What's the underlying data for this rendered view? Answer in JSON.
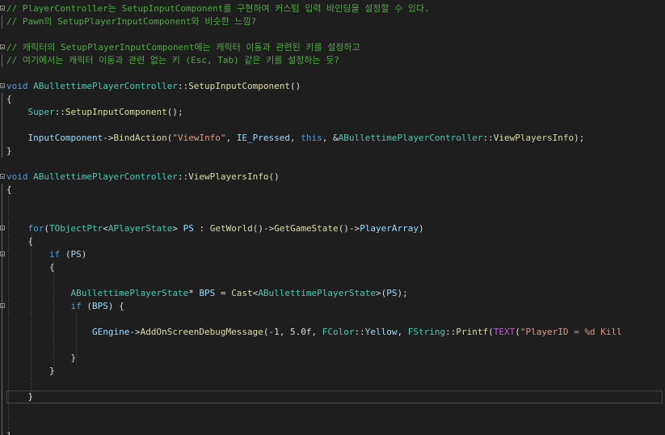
{
  "editor": {
    "theme_colors": {
      "background": "#1e1e1e",
      "comment": "#57a64a",
      "keyword": "#569cd6",
      "type": "#4ec9b0",
      "function": "#dcdcaa",
      "string": "#d69d85",
      "variable": "#9cdcfe",
      "plain": "#dcdcdc",
      "macro": "#bd63c5"
    },
    "lines": [
      [
        [
          "c",
          "// PlayerController는 SetupInputComponent를 구현하여 커스텀 입력 바인딩을 설정할 수 있다."
        ]
      ],
      [
        [
          "c",
          "// Pawn의 SetupPlayerInputComponent와 비슷한 느낌?"
        ]
      ],
      [],
      [
        [
          "c",
          "// 캐릭터의 SetupPlayerInputComponent에는 캐릭터 이동과 관련된 키를 설정하고"
        ]
      ],
      [
        [
          "c",
          "// 여기에서는 캐릭터 이동과 관련 없는 키 (Esc, Tab) 같은 키를 설정하는 듯?"
        ]
      ],
      [],
      [
        [
          "k",
          "void "
        ],
        [
          "t",
          "ABullettimePlayerController"
        ],
        [
          "p",
          "::"
        ],
        [
          "f",
          "SetupInputComponent"
        ],
        [
          "p",
          "()"
        ]
      ],
      [
        [
          "p",
          "{"
        ]
      ],
      [
        [
          "p",
          "    "
        ],
        [
          "t",
          "Super"
        ],
        [
          "p",
          "::"
        ],
        [
          "f",
          "SetupInputComponent"
        ],
        [
          "p",
          "();"
        ]
      ],
      [],
      [
        [
          "p",
          "    "
        ],
        [
          "v",
          "InputComponent"
        ],
        [
          "p",
          "->"
        ],
        [
          "f",
          "BindAction"
        ],
        [
          "p",
          "("
        ],
        [
          "s",
          "\"ViewInfo\""
        ],
        [
          "p",
          ", "
        ],
        [
          "v",
          "IE_Pressed"
        ],
        [
          "p",
          ", "
        ],
        [
          "k",
          "this"
        ],
        [
          "p",
          ", &"
        ],
        [
          "t",
          "ABullettimePlayerController"
        ],
        [
          "p",
          "::"
        ],
        [
          "f",
          "ViewPlayersInfo"
        ],
        [
          "p",
          ");"
        ]
      ],
      [
        [
          "p",
          "}"
        ]
      ],
      [],
      [
        [
          "k",
          "void "
        ],
        [
          "t",
          "ABullettimePlayerController"
        ],
        [
          "p",
          "::"
        ],
        [
          "f",
          "ViewPlayersInfo"
        ],
        [
          "p",
          "()"
        ]
      ],
      [
        [
          "p",
          "{"
        ]
      ],
      [],
      [],
      [
        [
          "p",
          "    "
        ],
        [
          "k",
          "for"
        ],
        [
          "p",
          "("
        ],
        [
          "t",
          "TObjectPtr"
        ],
        [
          "p",
          "<"
        ],
        [
          "t",
          "APlayerState"
        ],
        [
          "p",
          "> "
        ],
        [
          "v",
          "PS"
        ],
        [
          "p",
          " : "
        ],
        [
          "f",
          "GetWorld"
        ],
        [
          "p",
          "()->"
        ],
        [
          "f",
          "GetGameState"
        ],
        [
          "p",
          "()->"
        ],
        [
          "v",
          "PlayerArray"
        ],
        [
          "p",
          ")"
        ]
      ],
      [
        [
          "p",
          "    {"
        ]
      ],
      [
        [
          "p",
          "        "
        ],
        [
          "k",
          "if"
        ],
        [
          "p",
          " ("
        ],
        [
          "v",
          "PS"
        ],
        [
          "p",
          ")"
        ]
      ],
      [
        [
          "p",
          "        {"
        ]
      ],
      [],
      [
        [
          "p",
          "            "
        ],
        [
          "t",
          "ABullettimePlayerState"
        ],
        [
          "p",
          "* "
        ],
        [
          "v",
          "BPS"
        ],
        [
          "p",
          " = "
        ],
        [
          "f",
          "Cast"
        ],
        [
          "p",
          "<"
        ],
        [
          "t",
          "ABullettimePlayerState"
        ],
        [
          "p",
          ">("
        ],
        [
          "v",
          "PS"
        ],
        [
          "p",
          ");"
        ]
      ],
      [
        [
          "p",
          "            "
        ],
        [
          "k",
          "if"
        ],
        [
          "p",
          " ("
        ],
        [
          "v",
          "BPS"
        ],
        [
          "p",
          ") {"
        ]
      ],
      [],
      [
        [
          "p",
          "                "
        ],
        [
          "v",
          "GEngine"
        ],
        [
          "p",
          "->"
        ],
        [
          "f",
          "AddOnScreenDebugMessage"
        ],
        [
          "p",
          "(-1, 5.0f, "
        ],
        [
          "t",
          "FColor"
        ],
        [
          "p",
          "::"
        ],
        [
          "v",
          "Yellow"
        ],
        [
          "p",
          ", "
        ],
        [
          "t",
          "FString"
        ],
        [
          "p",
          "::"
        ],
        [
          "f",
          "Printf"
        ],
        [
          "p",
          "("
        ],
        [
          "m",
          "TEXT"
        ],
        [
          "p",
          "("
        ],
        [
          "s",
          "\"PlayerID = %d Kill"
        ]
      ],
      [],
      [
        [
          "p",
          "            }"
        ]
      ],
      [
        [
          "p",
          "        }"
        ]
      ],
      [],
      [
        [
          "p",
          "    }"
        ]
      ],
      [],
      [],
      [
        [
          "p",
          "}"
        ]
      ]
    ]
  }
}
